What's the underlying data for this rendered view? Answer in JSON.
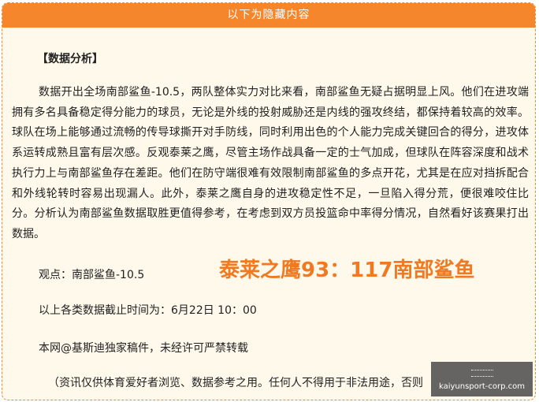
{
  "panel": {
    "header_title": "以下为隐藏内容"
  },
  "article": {
    "section_title": "【数据分析】",
    "analysis": "数据开出全场南部鲨鱼-10.5，两队整体实力对比来看，南部鲨鱼无疑占据明显上风。他们在进攻端拥有多名具备稳定得分能力的球员，无论是外线的投射威胁还是内线的强攻终结，都保持着较高的效率。球队在场上能够通过流畅的传导球撕开对手防线，同时利用出色的个人能力完成关键回合的得分，进攻体系运转成熟且富有层次感。反观泰莱之鹰，尽管主场作战具备一定的士气加成，但球队在阵容深度和战术执行力上与南部鲨鱼存在差距。他们在防守端很难有效限制南部鲨鱼的多点开花，尤其是在应对挡拆配合和外线轮转时容易出现漏人。此外，泰莱之鹰自身的进攻稳定性不足，一旦陷入得分荒，便很难咬住比分。分析认为南部鲨鱼数据取胜更值得参考，在考虑到双方员投篮命中率得分情况，自然看好该赛果打出数据。",
    "viewpoint": "观点：南部鲨鱼-10.5",
    "score": "泰莱之鹰93：117南部鲨鱼",
    "cutoff": "以上各类数据截止时间为：6月22日 10：00",
    "copyright": "本网@基斯迪独家稿件，未经许可严禁转载",
    "disclaimer": "（资讯仅供体育爱好者浏览、数据参考之用。任何人不得用于非法用途，否则"
  },
  "watermark": {
    "url": "kaiyunsport-corp.com",
    "logo_icon": "logo-icon"
  },
  "colors": {
    "accent": "#f5862c",
    "panel_background": "#fff9ec",
    "score_text": "#f07a22"
  }
}
